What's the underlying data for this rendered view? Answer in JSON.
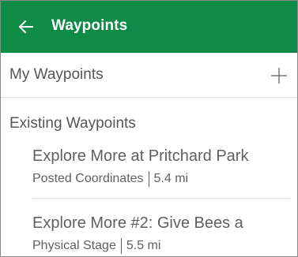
{
  "appbar": {
    "title": "Waypoints",
    "back_icon": "arrow-left-icon",
    "color": "#0f8a47"
  },
  "my_waypoints": {
    "label": "My Waypoints",
    "add_icon": "plus-icon"
  },
  "existing": {
    "label": "Existing Waypoints",
    "items": [
      {
        "title": "Explore More at Pritchard Park",
        "type": "Posted Coordinates",
        "distance": "5.4 mi"
      },
      {
        "title": "Explore More #2: Give Bees a",
        "type": "Physical Stage",
        "distance": "5.5 mi"
      }
    ]
  }
}
